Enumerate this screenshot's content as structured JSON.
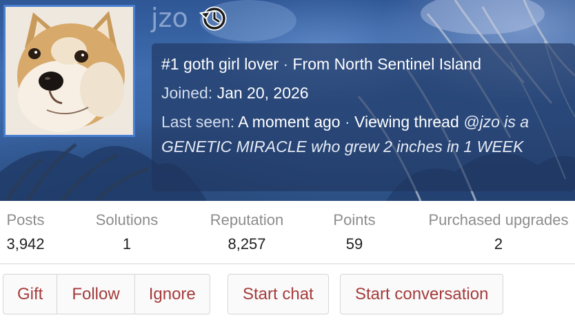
{
  "profile": {
    "username": "jzo",
    "custom_title": "#1 goth girl lover",
    "location_prefix": "From",
    "location": "North Sentinel Island",
    "joined_label": "Joined:",
    "joined_date": "Jan 20, 2026",
    "last_seen_label": "Last seen:",
    "last_seen_time": "A moment ago",
    "activity": "Viewing thread",
    "activity_thread": "@jzo is a GENETIC MIRACLE who grew 2 inches in 1 WEEK",
    "separator": "·"
  },
  "stats": [
    {
      "label": "Posts",
      "value": "3,942"
    },
    {
      "label": "Solutions",
      "value": "1"
    },
    {
      "label": "Reputation",
      "value": "8,257"
    },
    {
      "label": "Points",
      "value": "59"
    },
    {
      "label": "Purchased upgrades",
      "value": "2"
    }
  ],
  "actions": {
    "gift": "Gift",
    "follow": "Follow",
    "ignore": "Ignore",
    "start_chat": "Start chat",
    "start_conversation": "Start conversation"
  },
  "colors": {
    "banner": "#3e6cae",
    "avatar_border": "#4a7fd0",
    "info_box": "#1e345c",
    "button_text": "#a53b3b"
  },
  "icons": {
    "history": "history-icon"
  }
}
